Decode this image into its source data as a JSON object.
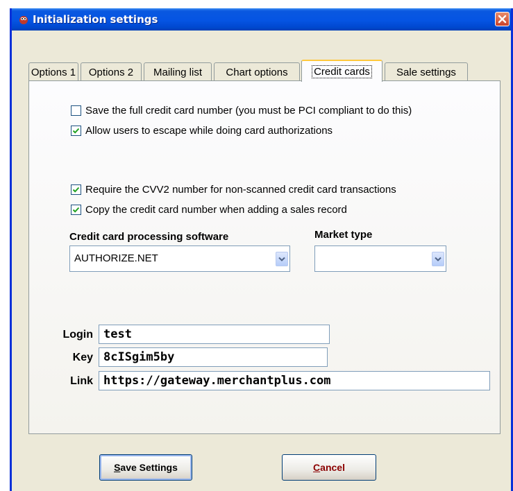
{
  "window": {
    "title": "Initialization settings"
  },
  "tabs": [
    {
      "label": "Options 1"
    },
    {
      "label": "Options 2"
    },
    {
      "label": "Mailing list"
    },
    {
      "label": "Chart options"
    },
    {
      "label": "Credit cards"
    },
    {
      "label": "Sale settings"
    }
  ],
  "active_tab": "Credit cards",
  "checkboxes": [
    {
      "label": "Save the full credit card number (you must be PCI compliant to do this)",
      "checked": false
    },
    {
      "label": "Allow users to escape while doing card authorizations",
      "checked": true
    },
    {
      "label": "Require the CVV2 number for non-scanned credit card transactions",
      "checked": true
    },
    {
      "label": "Copy the credit card number when adding a sales record",
      "checked": true
    }
  ],
  "processing": {
    "label": "Credit card processing software",
    "value": "AUTHORIZE.NET"
  },
  "market": {
    "label": "Market type",
    "value": ""
  },
  "fields": {
    "login": {
      "label": "Login",
      "value": "test"
    },
    "key": {
      "label": "Key",
      "value": "8cISgim5by"
    },
    "link": {
      "label": "Link",
      "value": "https://gateway.merchantplus.com"
    }
  },
  "buttons": {
    "save": {
      "label": "Save Settings",
      "accel": "S",
      "rest": "ave Settings"
    },
    "cancel": {
      "label": "Cancel",
      "accel": "C",
      "rest": "ancel"
    }
  },
  "colors": {
    "titlebar": "#0554e3",
    "tab_highlight": "#ffc83c",
    "window_bg": "#ece9d8"
  }
}
